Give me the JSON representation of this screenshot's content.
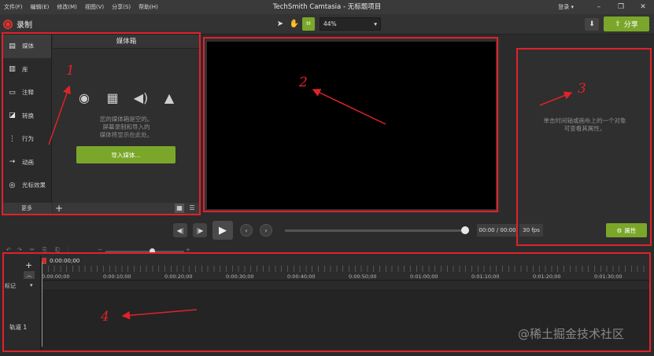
{
  "menu": {
    "items": [
      "文件(F)",
      "编辑(E)",
      "修改(M)",
      "视图(V)",
      "分享(S)",
      "帮助(H)"
    ],
    "title": "TechSmith Camtasia - 无标题项目",
    "login": "登录 ▾"
  },
  "toolbar": {
    "record_label": "录制",
    "zoom": "44%",
    "share_label": "分享"
  },
  "sidebar": {
    "items": [
      {
        "label": "媒体",
        "icon": "film-strip-icon"
      },
      {
        "label": "库",
        "icon": "library-icon"
      },
      {
        "label": "注释",
        "icon": "annotation-icon"
      },
      {
        "label": "转换",
        "icon": "transition-icon"
      },
      {
        "label": "行为",
        "icon": "behavior-icon"
      },
      {
        "label": "动画",
        "icon": "animation-icon"
      },
      {
        "label": "光标效果",
        "icon": "cursor-effect-icon"
      }
    ],
    "more": "更多"
  },
  "media_bin": {
    "title": "媒体箱",
    "message_line1": "您的媒体箱是空的。",
    "message_line2": "屏幕录制和导入的",
    "message_line3": "媒体将显示在此处。",
    "import_label": "导入媒体..."
  },
  "properties": {
    "message_line1": "单击时间轴或画布上的一个对象",
    "message_line2": "可查看其属性。",
    "button_label": "属性"
  },
  "playback": {
    "time": "00:00 / 00:00",
    "fps": "30 fps",
    "progress": 1.0
  },
  "timeline": {
    "playhead_time": "0:00:00;00",
    "ticks": [
      "0:00:00;00",
      "0:00:10;00",
      "0:00:20;00",
      "0:00:30;00",
      "0:00:40;00",
      "0:00:50;00",
      "0:01:00;00",
      "0:01:10;00",
      "0:01:20;00",
      "0:01:30;00"
    ],
    "marker_label": "标记",
    "track_label": "轨道 1"
  },
  "annotations": [
    "1",
    "2",
    "3",
    "4"
  ],
  "watermark": "@稀土掘金技术社区",
  "colors": {
    "accent_green": "#7aa72a",
    "record_red": "#e53030",
    "annotation_red": "#e0222a"
  }
}
